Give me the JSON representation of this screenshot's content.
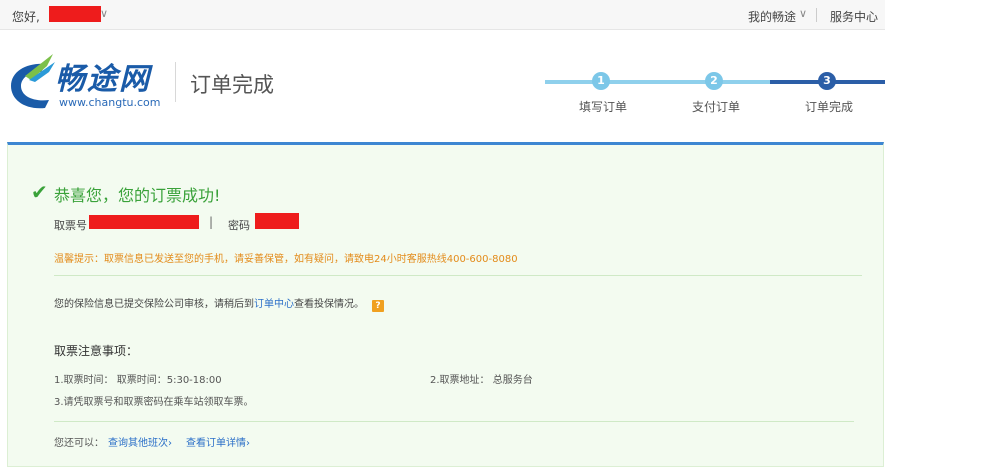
{
  "topbar": {
    "greeting": "您好,",
    "my_trip": "我的畅途",
    "service_center": "服务中心",
    "caret": "∨"
  },
  "header": {
    "brand": "畅途网",
    "brand_url": "www.changtu.com",
    "page_title": "订单完成"
  },
  "steps": [
    {
      "num": "1",
      "label": "填写订单",
      "state": "done"
    },
    {
      "num": "2",
      "label": "支付订单",
      "state": "done"
    },
    {
      "num": "3",
      "label": "订单完成",
      "state": "current"
    }
  ],
  "result": {
    "check_icon": "✔",
    "title": "恭喜您，您的订票成功!",
    "ticket_no_label": "取票号",
    "separator": "|",
    "password_label": "密码",
    "tip": "温馨提示：取票信息已发送至您的手机，请妥善保管，如有疑问，请致电24小时客服热线400-600-8080",
    "insurance_prefix": "您的保险信息已提交保险公司审核，请稍后到",
    "insurance_link": "订单中心",
    "insurance_suffix": "查看投保情况。",
    "help_icon": "?",
    "notes_title": "取票注意事项：",
    "note1": "1.取票时间：  取票时间：5:30-18:00",
    "note2": "2.取票地址：  总服务台",
    "note3": "3.请凭取票号和取票密码在乘车站领取车票。",
    "more_prefix": "您还可以：",
    "more_link1": "查询其他班次›",
    "more_link2": "查看订单详情›"
  },
  "colors": {
    "brand_blue": "#1a5ba8",
    "success_green": "#3aa23a",
    "tip_orange": "#e38b1a",
    "link_blue": "#2b6fc8",
    "redaction_red": "#ee1c1c"
  }
}
